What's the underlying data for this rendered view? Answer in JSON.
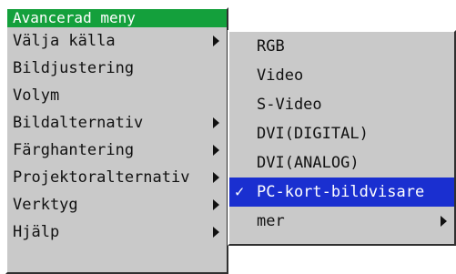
{
  "main_menu": {
    "title": "Avancerad meny",
    "items": [
      {
        "label": "Välja källa",
        "has_submenu": true
      },
      {
        "label": "Bildjustering",
        "has_submenu": false
      },
      {
        "label": "Volym",
        "has_submenu": false
      },
      {
        "label": "Bildalternativ",
        "has_submenu": true
      },
      {
        "label": "Färghantering",
        "has_submenu": true
      },
      {
        "label": "Projektoralternativ",
        "has_submenu": true
      },
      {
        "label": "Verktyg",
        "has_submenu": true
      },
      {
        "label": "Hjälp",
        "has_submenu": true
      }
    ]
  },
  "source_submenu": {
    "items": [
      {
        "label": "RGB",
        "selected": false
      },
      {
        "label": "Video",
        "selected": false
      },
      {
        "label": "S-Video",
        "selected": false
      },
      {
        "label": "DVI(DIGITAL)",
        "selected": false
      },
      {
        "label": "DVI(ANALOG)",
        "selected": false
      },
      {
        "label": "PC-kort-bildvisare",
        "selected": true,
        "check": "✓"
      },
      {
        "label": "mer",
        "selected": false,
        "has_submenu": true
      }
    ]
  },
  "colors": {
    "menu_background": "#c9c9c9",
    "title_background": "#14a03c",
    "selection_background": "#1a2fd0"
  },
  "icons": {
    "submenu_arrow": "arrow-right-icon",
    "selected_mark": "checkmark-icon"
  }
}
